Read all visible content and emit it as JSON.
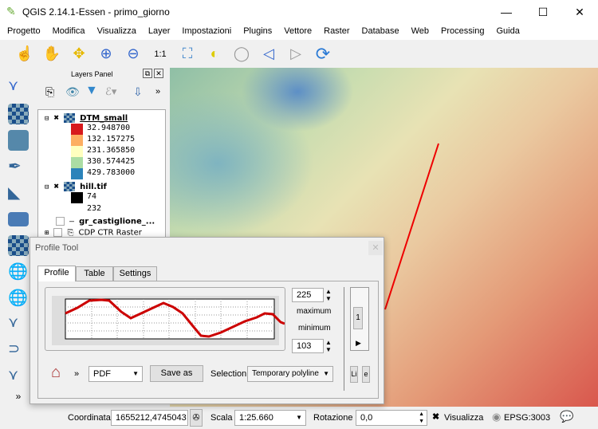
{
  "window": {
    "title": "QGIS 2.14.1-Essen - primo_giorno"
  },
  "menu": [
    "Progetto",
    "Modifica",
    "Visualizza",
    "Layer",
    "Impostazioni",
    "Plugins",
    "Vettore",
    "Raster",
    "Database",
    "Web",
    "Processing",
    "Guida"
  ],
  "toolbar": [
    "touch-icon",
    "pan-icon",
    "pan-to-selection-icon",
    "zoom-in-icon",
    "zoom-out-icon",
    "zoom-native-icon",
    "zoom-full-icon",
    "zoom-to-selection-icon",
    "zoom-to-layer-icon",
    "zoom-last-icon",
    "zoom-next-icon",
    "refresh-icon"
  ],
  "layers_panel": {
    "title": "Layers Panel",
    "more": "»",
    "layers": [
      {
        "name": "DTM_small",
        "legend": [
          {
            "label": "32.948700",
            "color": "#d7191c"
          },
          {
            "label": "132.157275",
            "color": "#fdae61"
          },
          {
            "label": "231.365850",
            "color": "#ffffbf"
          },
          {
            "label": "330.574425",
            "color": "#abdda4"
          },
          {
            "label": "429.783000",
            "color": "#2b83ba"
          }
        ]
      },
      {
        "name": "hill.tif",
        "legend": [
          {
            "label": "74",
            "color": "#000000"
          },
          {
            "label": "232",
            "color": "#ffffff"
          }
        ]
      },
      {
        "name": "gr_castiglione_..."
      },
      {
        "name": "CDP CTR Raster"
      }
    ]
  },
  "profile_tool": {
    "title": "Profile Tool",
    "tabs": [
      "Profile",
      "Table",
      "Settings"
    ],
    "max_value": "225",
    "max_label": "maximum",
    "min_label": "minimum",
    "min_value": "103",
    "page": "1",
    "more": "»",
    "format": "PDF",
    "save_as": "Save as",
    "selection_label": "Selection",
    "selection": "Temporary polyline",
    "btn_l": "Li",
    "btn_e": "e",
    "line_color": "#cc0000"
  },
  "status": {
    "coord_label": "Coordinata",
    "coord": "1655212,4745043",
    "scale_label": "Scala",
    "scale": "1:25.660",
    "rotation_label": "Rotazione",
    "rotation": "0,0",
    "render_label": "Visualizza",
    "crs": "EPSG:3003"
  }
}
